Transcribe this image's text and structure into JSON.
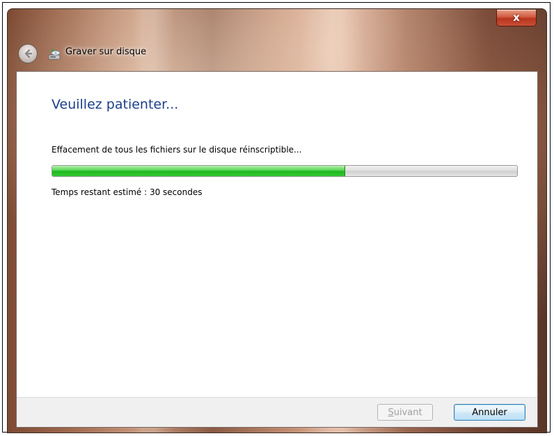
{
  "window": {
    "title": "Graver sur disque",
    "close_label": "x"
  },
  "content": {
    "heading": "Veuillez patienter...",
    "status": "Effacement de tous les fichiers sur le disque réinscriptible...",
    "progress_percent": 63,
    "time_remaining": "Temps restant estimé : 30 secondes"
  },
  "footer": {
    "next_label_mnemonic": "S",
    "next_label_rest": "uivant",
    "cancel_label": "Annuler"
  },
  "colors": {
    "heading": "#1e3f8a",
    "progress_fill": "#1fb81f",
    "close_button": "#c85035"
  },
  "icons": {
    "back": "back-arrow-icon",
    "title": "disc-burner-icon",
    "close": "close-icon"
  }
}
